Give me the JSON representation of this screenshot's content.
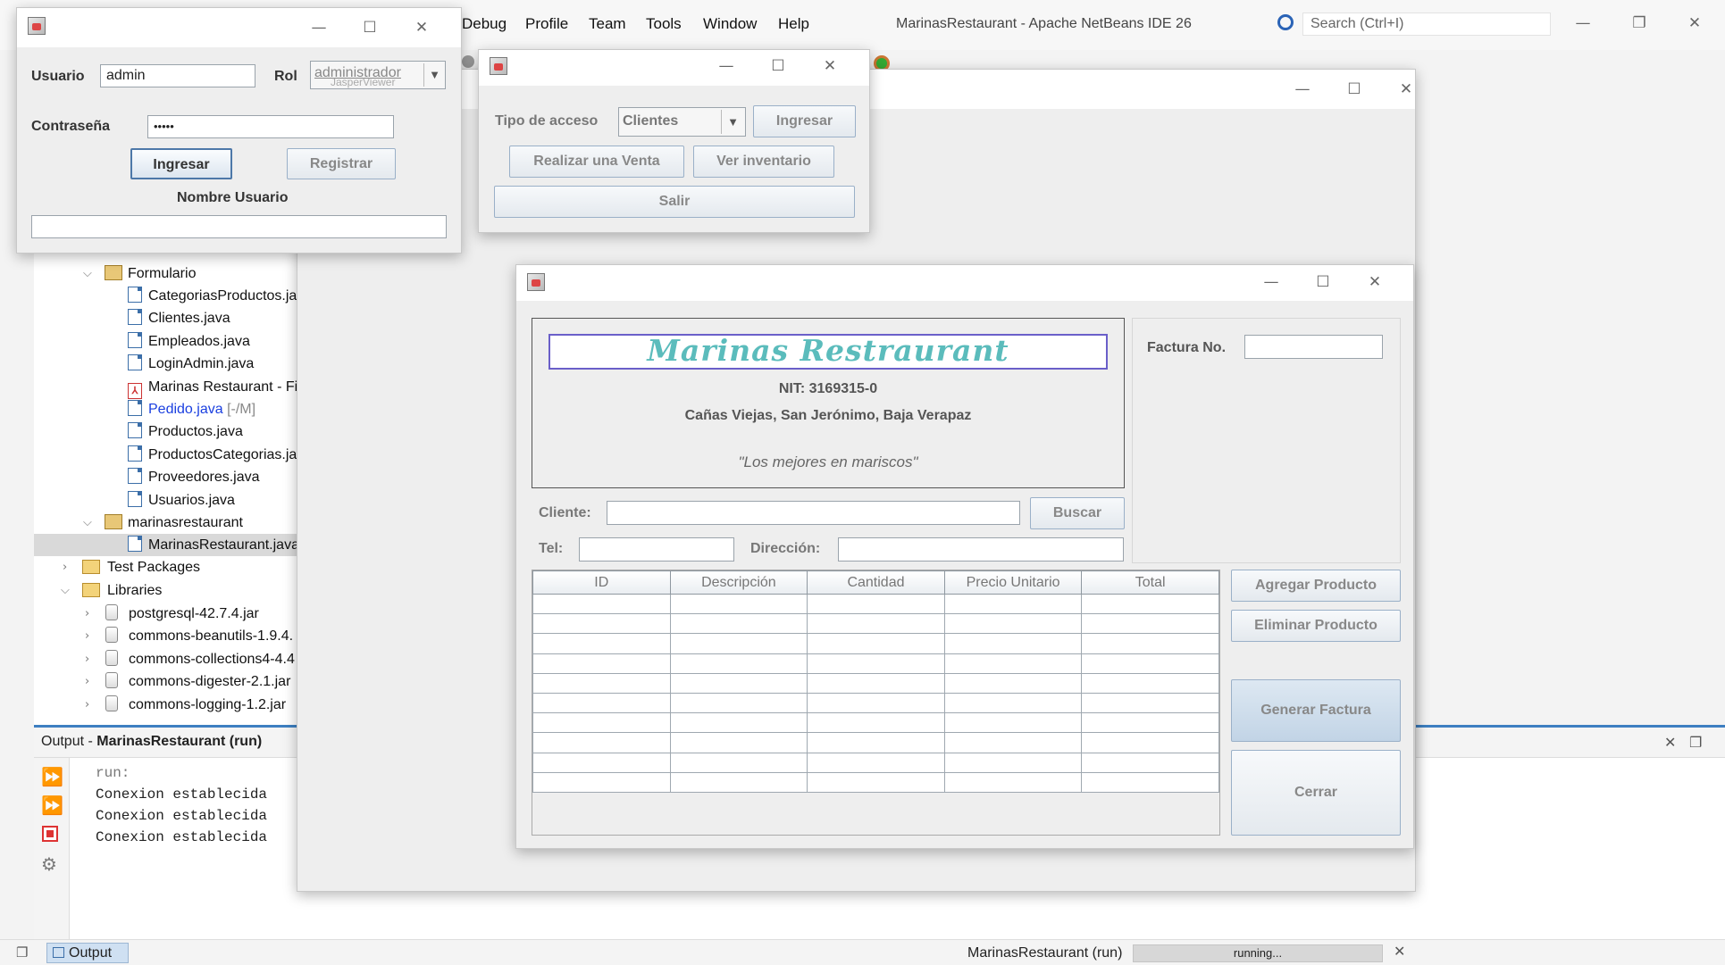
{
  "ide": {
    "title": "MarinasRestaurant - Apache NetBeans IDE 26",
    "menu": [
      "Debug",
      "Profile",
      "Team",
      "Tools",
      "Window",
      "Help"
    ],
    "search_placeholder": "Search (Ctrl+I)",
    "project_tree": [
      {
        "label": "Formulario",
        "kind": "package",
        "level": 1
      },
      {
        "label": "CategoriasProductos.ja",
        "kind": "java",
        "level": 2
      },
      {
        "label": "Clientes.java",
        "kind": "java",
        "level": 2
      },
      {
        "label": "Empleados.java",
        "kind": "java",
        "level": 2
      },
      {
        "label": "LoginAdmin.java",
        "kind": "java",
        "level": 2
      },
      {
        "label": "Marinas Restaurant - Fi",
        "kind": "pdf",
        "level": 2
      },
      {
        "label": "Pedido.java",
        "suffix": "[-/M]",
        "kind": "java",
        "level": 2,
        "modified": true
      },
      {
        "label": "Productos.java",
        "kind": "java",
        "level": 2
      },
      {
        "label": "ProductosCategorias.ja",
        "kind": "java",
        "level": 2
      },
      {
        "label": "Proveedores.java",
        "kind": "java",
        "level": 2
      },
      {
        "label": "Usuarios.java",
        "kind": "java",
        "level": 2
      },
      {
        "label": "marinasrestaurant",
        "kind": "package",
        "level": 1
      },
      {
        "label": "MarinasRestaurant.java",
        "kind": "java",
        "level": 2,
        "selected": true
      },
      {
        "label": "Test Packages",
        "kind": "folder",
        "level": 0
      },
      {
        "label": "Libraries",
        "kind": "folder",
        "level": 0
      },
      {
        "label": "postgresql-42.7.4.jar",
        "kind": "jar",
        "level": 1
      },
      {
        "label": "commons-beanutils-1.9.4.",
        "kind": "jar",
        "level": 1
      },
      {
        "label": "commons-collections4-4.4",
        "kind": "jar",
        "level": 1
      },
      {
        "label": "commons-digester-2.1.jar",
        "kind": "jar",
        "level": 1
      },
      {
        "label": "commons-logging-1.2.jar",
        "kind": "jar",
        "level": 1
      }
    ],
    "output": {
      "title_prefix": "Output - ",
      "title": "MarinasRestaurant (run)",
      "lines": [
        "run:",
        "Conexion establecida",
        "Conexion establecida",
        "Conexion establecida"
      ]
    },
    "status": {
      "output_tab": "Output",
      "process": "MarinasRestaurant (run)",
      "progress_text": "running..."
    }
  },
  "login": {
    "usuario_label": "Usuario",
    "usuario_value": "admin",
    "rol_label": "Rol",
    "rol_value": "administrador",
    "jasper_ghost": "JasperViewer",
    "password_label": "Contraseña",
    "password_value": "•••••",
    "ingresar": "Ingresar",
    "registrar": "Registrar",
    "nombre_usuario_label": "Nombre Usuario",
    "nombre_usuario_value": ""
  },
  "menu_window": {
    "tipo_label": "Tipo de acceso",
    "tipo_value": "Clientes",
    "ingresar": "Ingresar",
    "venta": "Realizar una Venta",
    "inventario": "Ver inventario",
    "salir": "Salir"
  },
  "invoice": {
    "brand": "Marinas Restraurant",
    "nit": "NIT: 3169315-0",
    "address": "Cañas Viejas, San Jerónimo, Baja Verapaz",
    "slogan": "\"Los mejores en mariscos\"",
    "factura_label": "Factura No.",
    "factura_value": "",
    "cliente_label": "Cliente:",
    "cliente_value": "",
    "buscar": "Buscar",
    "tel_label": "Tel:",
    "tel_value": "",
    "direccion_label": "Dirección:",
    "direccion_value": "",
    "columns": [
      "ID",
      "Descripción",
      "Cantidad",
      "Precio Unitario",
      "Total"
    ],
    "agregar": "Agregar Producto",
    "eliminar": "Eliminar Producto",
    "generar": "Generar Factura",
    "cerrar": "Cerrar"
  },
  "colors": {
    "brand_text": "#5bbcbc",
    "brand_border": "#6a5fc9",
    "selection": "#d9d9d9",
    "modified_file": "#1a3fe0",
    "accent_line": "#3d7fc1"
  }
}
